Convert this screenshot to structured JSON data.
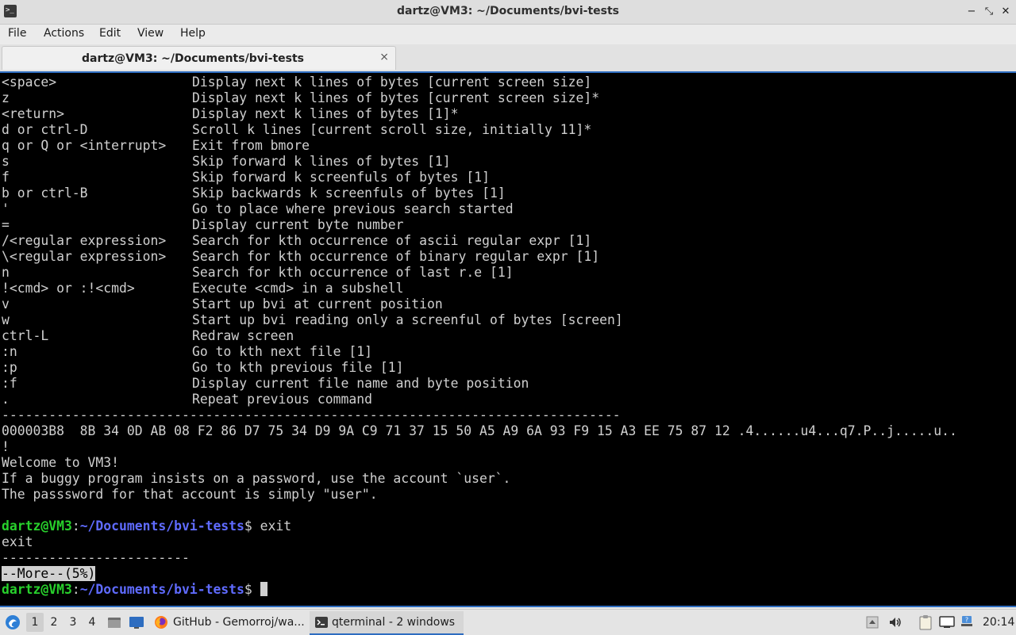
{
  "window": {
    "title": "dartz@VM3: ~/Documents/bvi-tests",
    "app_icon": ">_",
    "controls": {
      "minimize": "−",
      "maximize": "⤡",
      "close": "✕"
    }
  },
  "menu": {
    "items": [
      "File",
      "Actions",
      "Edit",
      "View",
      "Help"
    ]
  },
  "tab": {
    "title": "dartz@VM3: ~/Documents/bvi-tests",
    "close": "⨯"
  },
  "terminal": {
    "help_rows": [
      {
        "key": "<space>",
        "desc": "Display next k lines of bytes [current screen size]"
      },
      {
        "key": "z",
        "desc": "Display next k lines of bytes [current screen size]*"
      },
      {
        "key": "<return>",
        "desc": "Display next k lines of bytes [1]*"
      },
      {
        "key": "d or ctrl-D",
        "desc": "Scroll k lines [current scroll size, initially 11]*"
      },
      {
        "key": "q or Q or <interrupt>",
        "desc": "Exit from bmore"
      },
      {
        "key": "s",
        "desc": "Skip forward k lines of bytes [1]"
      },
      {
        "key": "f",
        "desc": "Skip forward k screenfuls of bytes [1]"
      },
      {
        "key": "b or ctrl-B",
        "desc": "Skip backwards k screenfuls of bytes [1]"
      },
      {
        "key": "'",
        "desc": "Go to place where previous search started"
      },
      {
        "key": "=",
        "desc": "Display current byte number"
      },
      {
        "key": "/<regular expression>",
        "desc": "Search for kth occurrence of ascii regular expr [1]"
      },
      {
        "key": "\\<regular expression>",
        "desc": "Search for kth occurrence of binary regular expr [1]"
      },
      {
        "key": "n",
        "desc": "Search for kth occurrence of last r.e [1]"
      },
      {
        "key": "!<cmd> or :!<cmd>",
        "desc": "Execute <cmd> in a subshell"
      },
      {
        "key": "v",
        "desc": "Start up bvi at current position"
      },
      {
        "key": "w",
        "desc": "Start up bvi reading only a screenful of bytes [screen]"
      },
      {
        "key": "ctrl-L",
        "desc": "Redraw screen"
      },
      {
        "key": ":n",
        "desc": "Go to kth next file [1]"
      },
      {
        "key": ":p",
        "desc": "Go to kth previous file [1]"
      },
      {
        "key": ":f",
        "desc": "Display current file name and byte position"
      },
      {
        "key": ".",
        "desc": "Repeat previous command"
      }
    ],
    "separator_long": "-------------------------------------------------------------------------------",
    "hex_line": "000003B8  8B 34 0D AB 08 F2 86 D7 75 34 D9 9A C9 71 37 15 50 A5 A9 6A 93 F9 15 A3 EE 75 87 12 .4......u4...q7.P..j.....u..",
    "bang": "!",
    "welcome": "Welcome to VM3!",
    "motd1": "If a buggy program insists on a password, use the account `user`.",
    "motd2": "The passsword for that account is simply \"user\".",
    "prompt_user": "dartz@VM3",
    "prompt_colon": ":",
    "prompt_path": "~/Documents/bvi-tests",
    "prompt_dollar": "$ ",
    "command": "exit",
    "echo": "exit",
    "separator_short": "------------------------",
    "more": "--More--(5%)"
  },
  "taskbar": {
    "start_icon": "menu-icon",
    "desktops": [
      "1",
      "2",
      "3",
      "4"
    ],
    "active_desktop": "1",
    "tasks": [
      {
        "label": "GitHub - Gemorroj/wa...",
        "icon": "firefox-icon"
      },
      {
        "label": "qterminal - 2 windows",
        "icon": "terminal-icon"
      }
    ],
    "clock": "20:14"
  }
}
